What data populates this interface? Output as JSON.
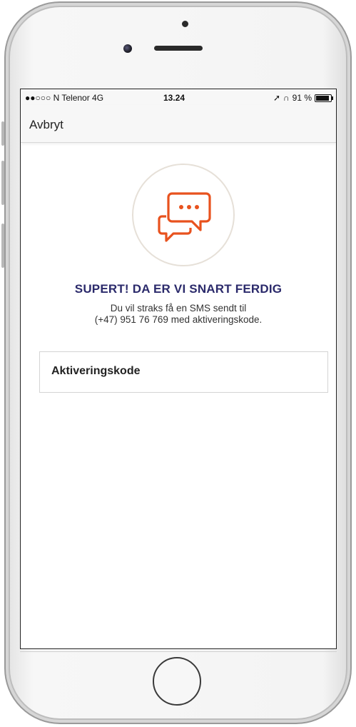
{
  "status_bar": {
    "carrier": "●●○○○ N Telenor  4G",
    "time": "13.24",
    "right": "91 %",
    "battery_level": 0.91
  },
  "navbar": {
    "cancel_label": "Avbryt"
  },
  "main": {
    "icon": "chat-bubbles-icon",
    "accent_color": "#e8521e",
    "headline": "SUPERT! DA ER VI SNART FERDIG",
    "subtext_line1": "Du vil straks få en SMS sendt til",
    "subtext_line2": "(+47) 951 76 769 med aktiveringskode.",
    "code_placeholder": "Aktiveringskode"
  }
}
